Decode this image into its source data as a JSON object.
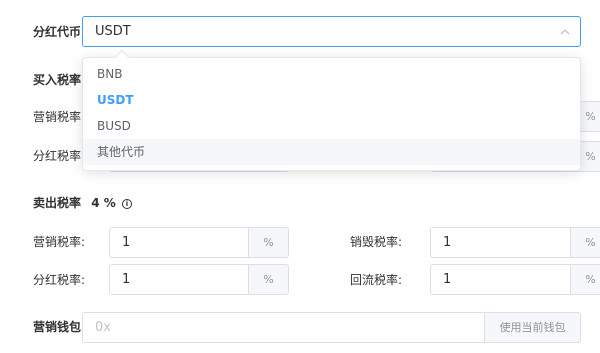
{
  "dividend_token": {
    "label": "分红代币",
    "value": "USDT",
    "options": [
      {
        "label": "BNB",
        "selected": false
      },
      {
        "label": "USDT",
        "selected": true
      },
      {
        "label": "BUSD",
        "selected": false
      },
      {
        "label": "其他代币",
        "selected": false
      }
    ]
  },
  "buy_tax": {
    "label": "买入税率",
    "marketing_label": "营销税率:",
    "dividend_label": "分红税率:",
    "suffix": "%"
  },
  "sell_tax": {
    "label": "卖出税率",
    "total": "4 %",
    "info_icon_char": "i",
    "marketing_label": "营销税率:",
    "marketing_value": "1",
    "burn_label": "销毁税率:",
    "burn_value": "1",
    "dividend_label": "分红税率:",
    "dividend_value": "1",
    "reflow_label": "回流税率:",
    "reflow_value": "1",
    "suffix": "%"
  },
  "marketing_wallet": {
    "label": "营销钱包",
    "placeholder": "0x",
    "button": "使用当前钱包"
  },
  "colors": {
    "accent": "#409eff",
    "border": "#dcdfe6",
    "append_bg": "#f5f7fa"
  }
}
